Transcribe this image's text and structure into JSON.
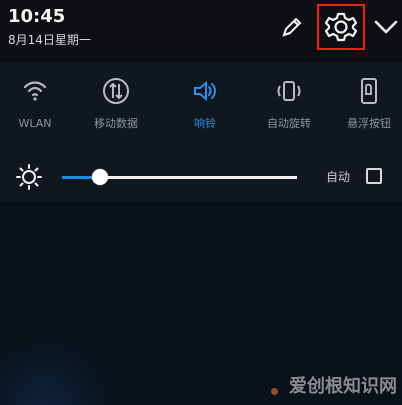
{
  "status": {
    "time": "10:45",
    "date": "8月14日星期一"
  },
  "header": {
    "edit_icon": "pencil-icon",
    "settings_icon": "gear-icon",
    "expand_icon": "chevron-down-icon"
  },
  "quick_settings": [
    {
      "label": "WLAN",
      "icon": "wifi-icon",
      "active": false
    },
    {
      "label": "移动数据",
      "icon": "mobile-data-icon",
      "active": false
    },
    {
      "label": "响铃",
      "icon": "speaker-icon",
      "active": true
    },
    {
      "label": "自动旋转",
      "icon": "rotate-icon",
      "active": false
    },
    {
      "label": "悬浮按钮",
      "icon": "floating-button-icon",
      "active": false
    }
  ],
  "brightness": {
    "icon": "brightness-icon",
    "level_fraction": 0.16,
    "auto_label": "自动",
    "auto_checked": false
  },
  "watermark": {
    "text": "爱创根知识网"
  },
  "colors": {
    "accent": "#2d8ee8",
    "highlight_box": "#ff1a1a",
    "background": "#0b1118"
  }
}
